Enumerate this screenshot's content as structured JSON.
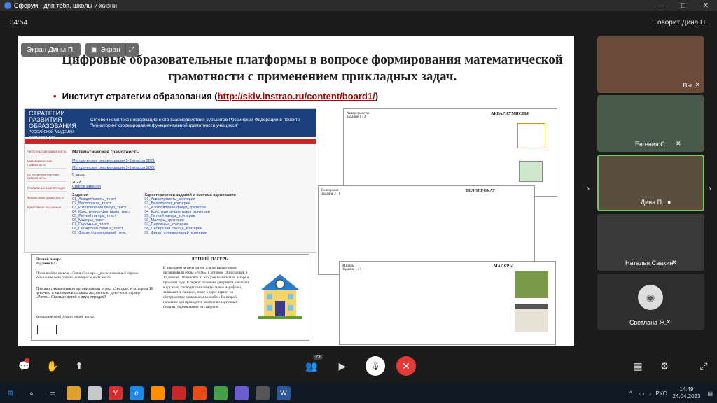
{
  "window": {
    "title": "Сферум - для тебя, школы и жизни",
    "minimize": "—",
    "maximize": "□",
    "close": "✕"
  },
  "call": {
    "timer": "34:54",
    "speaking": "Говорит Дина П."
  },
  "badges": {
    "screen_owner": "Экран Дины П.",
    "screen_tab": "Экран"
  },
  "slide": {
    "title": "Цифровые образовательные платформы в вопросе формирования математической грамотности с применением прикладных задач.",
    "bullet": "Институт стратегии образования (",
    "link": "http://skiv.instrao.ru/content/board1/",
    "bullet_end": ")"
  },
  "site": {
    "org": "ИНСТИТУТ СТРАТЕГИИ РАЗВИТИЯ ОБРАЗОВАНИЯ",
    "org_sub": "РОССИЙСКОЙ АКАДЕМИИ ОБРАЗОВАНИЯ",
    "project": "Сетевой комплекс информационного взаимодействия субъектов Российской Федерации в проекте \"Мониторинг формирования функциональной грамотности учащихся\"",
    "heading": "Математическая грамотность",
    "link1": "Методические рекомендации 5-9 классы 2021",
    "link2": "Методические рекомендации 5-9 классы 2022",
    "grade": "5 класс",
    "year": "2022",
    "list_tasks": "Список заданий",
    "col_tasks": "Задания",
    "col_char": "Характеристики заданий и система оценивания",
    "side": [
      "Читательская грамотность",
      "Математическая грамотность",
      "Естественно-научная грамотность",
      "Глобальные компетенции",
      "Финансовая грамотность",
      "Креативное мышление"
    ],
    "tasks": [
      "01_Аквариумисты_текст",
      "02_Велопрокат_текст",
      "03_Изготовление фигур_текст",
      "04_Конструктор-фантазия_текст",
      "05_Летний лагерь_текст",
      "06_Маляры_текст",
      "07_Пирожные_текст",
      "08_Сибирская свонца_текст",
      "09_Финал соревнований_текст"
    ],
    "chars": [
      "01_Аквариумисты_критерии",
      "02_Велопрокат_критерии",
      "03_Изготовление фигур_критерии",
      "04_Конструктор-фантазия_критерии",
      "05_Летний лагерь_критерии",
      "06_Маляры_критерии",
      "07_Пирожные_критерии",
      "08_Сибирская свонца_критерии",
      "09_Финал соревнований_критерии"
    ]
  },
  "docs": {
    "aqua_title": "АКВАРИУМИСТЫ",
    "aqua_task": "Аквариумисты\nЗадание 1 / 3",
    "velo_title": "ВЕЛОПРОКАТ",
    "velo_task": "Велопрокат\nЗадание 2 / 8",
    "malyar_title": "МАЛЯРЫ",
    "malyar_task": "Маляры\nЗадание 1 / 3",
    "camp_title": "ЛЕТНИЙ ЛАГЕРЬ",
    "camp_task": "Летний лагерь\nЗадание 1 / 3",
    "camp_text": "Прочитайте текст «Летний лагерь», расположенный справа. Запишите свой ответ на вопрос в виде числа.",
    "camp_question": "Для шестиклассников организовали отряд «Звезда», в котором 16 девочек, а мальчиков столько же, сколько девочек в отряде «Ритм». Сколько детей в двух отрядах?",
    "camp_answer": "Запишите свой ответ в виде числа.",
    "camp_right": "В школьном летнем лагере для пятиклассников организовали отряд «Ритм», в котором 14 мальчиков и 12 девочек. 10 человек из них уже были в этом лагере в прошлом году. В первой половине дня ребята работают в кружках, проводят интеллектуальные марафоны, занимаются танцами, поют в хоре, играют на инструментах в школьном ансамбле. Во второй половине дня проводятся занятия в спортивных секциях, соревнования на стадионе."
  },
  "participants": [
    {
      "name": "Вы"
    },
    {
      "name": "Евгения С."
    },
    {
      "name": "Дина П."
    },
    {
      "name": "Наталья Саакин"
    },
    {
      "name": "Светлана Ж."
    }
  ],
  "controls": {
    "participants_count": "23"
  },
  "taskbar": {
    "lang": "РУС",
    "time": "14:49",
    "date": "24.04.2023"
  }
}
